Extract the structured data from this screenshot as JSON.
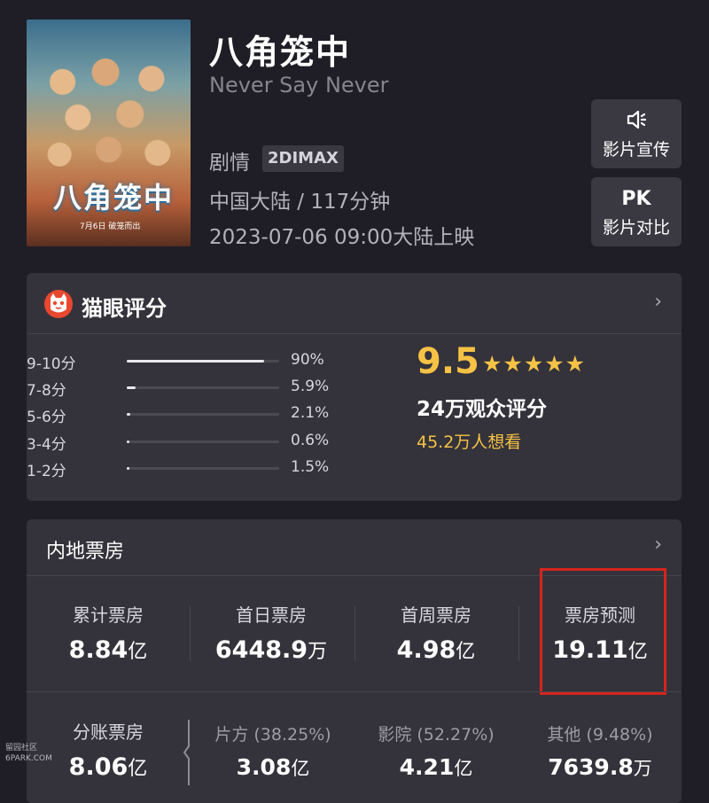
{
  "movie": {
    "poster_title": "八角笼中",
    "poster_date": "7月6日 破笼而出",
    "title": "八角笼中",
    "english_title": "Never Say Never",
    "genre": "剧情",
    "format": "2DIMAX",
    "region_duration": "中国大陆 / 117分钟",
    "release": "2023-07-06 09:00大陆上映"
  },
  "side_buttons": [
    {
      "label": "影片宣传",
      "icon": "speaker-icon"
    },
    {
      "label": "影片对比",
      "icon_text": "PK"
    }
  ],
  "rating": {
    "title": "猫眼评分",
    "score": "9.5",
    "stars": "★★★★★",
    "audience": "24万观众评分",
    "want": "45.2万人想看",
    "distribution": [
      {
        "label": "9-10分",
        "pct": "90%",
        "value": 90
      },
      {
        "label": "7-8分",
        "pct": "5.9%",
        "value": 5.9
      },
      {
        "label": "5-6分",
        "pct": "2.1%",
        "value": 2.1
      },
      {
        "label": "3-4分",
        "pct": "0.6%",
        "value": 0.6
      },
      {
        "label": "1-2分",
        "pct": "1.5%",
        "value": 1.5
      }
    ]
  },
  "box_office": {
    "title": "内地票房",
    "stats": [
      {
        "label": "累计票房",
        "value": "8.84",
        "unit": "亿"
      },
      {
        "label": "首日票房",
        "value": "6448.9",
        "unit": "万"
      },
      {
        "label": "首周票房",
        "value": "4.98",
        "unit": "亿"
      },
      {
        "label": "票房预测",
        "value": "19.11",
        "unit": "亿"
      }
    ],
    "split": {
      "label": "分账票房",
      "value": "8.06",
      "unit": "亿"
    },
    "split_parts": [
      {
        "label": "片方 (38.25%)",
        "value": "3.08",
        "unit": "亿"
      },
      {
        "label": "影院 (52.27%)",
        "value": "4.21",
        "unit": "亿"
      },
      {
        "label": "其他 (9.48%)",
        "value": "7639.8",
        "unit": "万"
      }
    ]
  },
  "watermark": {
    "line1": "留园社区",
    "line2": "6PARK.COM"
  },
  "colors": {
    "accent": "#f6c245",
    "highlight": "#d8241d",
    "background": "#1f1e26",
    "card": "#34333b"
  }
}
